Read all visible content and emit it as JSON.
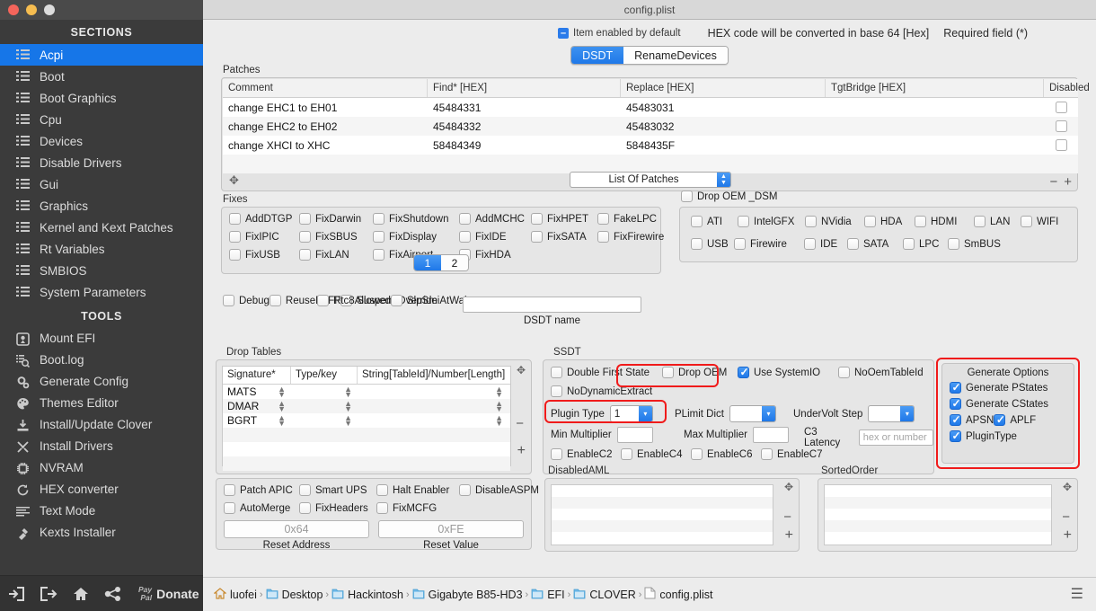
{
  "window": {
    "title": "config.plist"
  },
  "sidebar": {
    "sections_header": "SECTIONS",
    "tools_header": "TOOLS",
    "sections": [
      {
        "label": "Acpi",
        "icon": "list-icon",
        "active": true
      },
      {
        "label": "Boot",
        "icon": "list-icon"
      },
      {
        "label": "Boot Graphics",
        "icon": "list-icon"
      },
      {
        "label": "Cpu",
        "icon": "list-icon"
      },
      {
        "label": "Devices",
        "icon": "list-icon"
      },
      {
        "label": "Disable Drivers",
        "icon": "list-icon"
      },
      {
        "label": "Gui",
        "icon": "list-icon"
      },
      {
        "label": "Graphics",
        "icon": "list-icon"
      },
      {
        "label": "Kernel and Kext Patches",
        "icon": "list-icon"
      },
      {
        "label": "Rt Variables",
        "icon": "list-icon"
      },
      {
        "label": "SMBIOS",
        "icon": "list-icon"
      },
      {
        "label": "System Parameters",
        "icon": "list-icon"
      }
    ],
    "tools": [
      {
        "label": "Mount EFI",
        "icon": "disk-icon"
      },
      {
        "label": "Boot.log",
        "icon": "log-search-icon"
      },
      {
        "label": "Generate Config",
        "icon": "gears-icon"
      },
      {
        "label": "Themes Editor",
        "icon": "palette-icon"
      },
      {
        "label": "Install/Update Clover",
        "icon": "download-icon"
      },
      {
        "label": "Install Drivers",
        "icon": "tools-icon"
      },
      {
        "label": "NVRAM",
        "icon": "chip-icon"
      },
      {
        "label": "HEX converter",
        "icon": "refresh-icon"
      },
      {
        "label": "Text Mode",
        "icon": "lines-icon"
      },
      {
        "label": "Kexts Installer",
        "icon": "plug-icon"
      }
    ],
    "bottom_icons": [
      {
        "name": "import-icon"
      },
      {
        "name": "export-icon"
      },
      {
        "name": "home-icon"
      },
      {
        "name": "share-icon"
      }
    ],
    "donate": {
      "paypal_line1": "Pay",
      "paypal_line2": "Pal",
      "label": "Donate"
    }
  },
  "topbar": {
    "item_enabled_default": "Item enabled by default",
    "hex_note": "HEX code will be converted in base 64 [Hex]",
    "required_note": "Required field (*)"
  },
  "tabs": [
    {
      "label": "DSDT",
      "selected": true
    },
    {
      "label": "RenameDevices",
      "selected": false
    }
  ],
  "patches": {
    "title": "Patches",
    "columns": [
      "Comment",
      "Find* [HEX]",
      "Replace [HEX]",
      "TgtBridge [HEX]",
      "Disabled"
    ],
    "rows": [
      {
        "comment": "change EHC1 to EH01",
        "find": "45484331",
        "replace": "45483031",
        "tgtbridge": "",
        "disabled": false
      },
      {
        "comment": "change EHC2 to EH02",
        "find": "45484332",
        "replace": "45483032",
        "tgtbridge": "",
        "disabled": false
      },
      {
        "comment": "change XHCI to XHC",
        "find": "58484349",
        "replace": "5848435F",
        "tgtbridge": "",
        "disabled": false
      }
    ],
    "dropdown_value": "List Of Patches",
    "remove_label": "−",
    "add_label": "+"
  },
  "fixes": {
    "title": "Fixes",
    "row1": [
      {
        "label": "AddDTGP",
        "checked": false
      },
      {
        "label": "FixDarwin",
        "checked": false
      },
      {
        "label": "FixShutdown",
        "checked": false
      },
      {
        "label": "AddMCHC",
        "checked": false
      },
      {
        "label": "FixHPET",
        "checked": false
      },
      {
        "label": "FakeLPC",
        "checked": false
      }
    ],
    "row2": [
      {
        "label": "FixIPIC",
        "checked": false
      },
      {
        "label": "FixSBUS",
        "checked": false
      },
      {
        "label": "FixDisplay",
        "checked": false
      },
      {
        "label": "FixIDE",
        "checked": false
      },
      {
        "label": "FixSATA",
        "checked": false
      },
      {
        "label": "FixFirewire",
        "checked": false
      }
    ],
    "row3": [
      {
        "label": "FixUSB",
        "checked": false
      },
      {
        "label": "FixLAN",
        "checked": false
      },
      {
        "label": "FixAirport",
        "checked": false
      },
      {
        "label": "FixHDA",
        "checked": false
      }
    ],
    "pages": [
      {
        "label": "1",
        "selected": true
      },
      {
        "label": "2",
        "selected": false
      }
    ]
  },
  "drop_oem_dsm": {
    "title": "Drop OEM _DSM",
    "checked": false,
    "row1": [
      {
        "label": "ATI",
        "checked": false
      },
      {
        "label": "IntelGFX",
        "checked": false
      },
      {
        "label": "NVidia",
        "checked": false
      },
      {
        "label": "HDA",
        "checked": false
      },
      {
        "label": "HDMI",
        "checked": false
      },
      {
        "label": "LAN",
        "checked": false
      },
      {
        "label": "WIFI",
        "checked": false
      }
    ],
    "row2": [
      {
        "label": "USB",
        "checked": false
      },
      {
        "label": "Firewire",
        "checked": false
      },
      {
        "label": "IDE",
        "checked": false
      },
      {
        "label": "SATA",
        "checked": false
      },
      {
        "label": "LPC",
        "checked": false
      },
      {
        "label": "SmBUS",
        "checked": false
      }
    ]
  },
  "misc": {
    "col1": [
      {
        "label": "Debug",
        "checked": false
      },
      {
        "label": "ReuseFFFF",
        "checked": false
      },
      {
        "label": "SuspendOverride",
        "checked": false
      }
    ],
    "col2": [
      {
        "label": "Rtc8Allowed",
        "checked": false
      },
      {
        "label": "SlpSmiAtWake",
        "checked": false
      }
    ],
    "dsdt_name_label": "DSDT name",
    "dsdt_name_value": ""
  },
  "drop_tables": {
    "title": "Drop Tables",
    "columns": [
      "Signature*",
      "Type/key",
      "String[TableId]/Number[Length]"
    ],
    "rows": [
      {
        "signature": "MATS",
        "typekey": "",
        "string": ""
      },
      {
        "signature": "DMAR",
        "typekey": "",
        "string": ""
      },
      {
        "signature": "BGRT",
        "typekey": "",
        "string": ""
      }
    ],
    "remove_label": "−",
    "add_label": "+"
  },
  "ssdt": {
    "title": "SSDT",
    "row1": [
      {
        "label": "Double First State",
        "checked": false
      },
      {
        "label": "Drop OEM",
        "checked": false
      },
      {
        "label": "Use SystemIO",
        "checked": true,
        "highlighted": true
      },
      {
        "label": "NoOemTableId",
        "checked": false
      }
    ],
    "row2": [
      {
        "label": "NoDynamicExtract",
        "checked": false
      }
    ],
    "plugin_type": {
      "label": "Plugin Type",
      "value": "1",
      "highlighted": true
    },
    "plimit_dict": {
      "label": "PLimit Dict",
      "value": ""
    },
    "undervolt_step": {
      "label": "UnderVolt Step",
      "value": ""
    },
    "min_multiplier": {
      "label": "Min Multiplier",
      "value": ""
    },
    "max_multiplier": {
      "label": "Max Multiplier",
      "value": ""
    },
    "c3_latency": {
      "label": "C3 Latency",
      "value": "",
      "placeholder": "hex or number"
    },
    "enable_c": [
      {
        "label": "EnableC2",
        "checked": false
      },
      {
        "label": "EnableC4",
        "checked": false
      },
      {
        "label": "EnableC6",
        "checked": false
      },
      {
        "label": "EnableC7",
        "checked": false
      }
    ]
  },
  "generate_options": {
    "title": "Generate Options",
    "highlighted": true,
    "items": [
      {
        "label": "Generate PStates",
        "checked": true
      },
      {
        "label": "Generate CStates",
        "checked": true
      },
      {
        "label": "APSN",
        "checked": true
      },
      {
        "label": "APLF",
        "checked": true
      },
      {
        "label": "PluginType",
        "checked": true
      }
    ]
  },
  "bottom_left": {
    "row1": [
      {
        "label": "Patch APIC",
        "checked": false
      },
      {
        "label": "Smart UPS",
        "checked": false
      },
      {
        "label": "Halt Enabler",
        "checked": false
      },
      {
        "label": "DisableASPM",
        "checked": false
      }
    ],
    "row2": [
      {
        "label": "AutoMerge",
        "checked": false
      },
      {
        "label": "FixHeaders",
        "checked": false
      },
      {
        "label": "FixMCFG",
        "checked": false
      }
    ],
    "reset_address": {
      "label": "Reset Address",
      "placeholder": "0x64",
      "value": ""
    },
    "reset_value": {
      "label": "Reset Value",
      "placeholder": "0xFE",
      "value": ""
    }
  },
  "disabled_aml": {
    "title": "DisabledAML",
    "items": [],
    "remove_label": "−",
    "add_label": "+"
  },
  "sorted_order": {
    "title": "SortedOrder",
    "items": [],
    "remove_label": "−",
    "add_label": "+"
  },
  "breadcrumb": {
    "items": [
      {
        "label": "luofei",
        "icon": "home-icon"
      },
      {
        "label": "Desktop",
        "icon": "folder-icon"
      },
      {
        "label": "Hackintosh",
        "icon": "folder-icon"
      },
      {
        "label": "Gigabyte B85-HD3",
        "icon": "folder-icon"
      },
      {
        "label": "EFI",
        "icon": "folder-icon"
      },
      {
        "label": "CLOVER",
        "icon": "folder-icon"
      },
      {
        "label": "config.plist",
        "icon": "file-icon"
      }
    ],
    "menu_icon": "hamburger-icon"
  },
  "colors": {
    "accent_blue": "#1f78e8",
    "highlight_red": "#f01b1b",
    "sidebar_bg": "#3b3b3b",
    "panel_bg": "#ececec"
  }
}
